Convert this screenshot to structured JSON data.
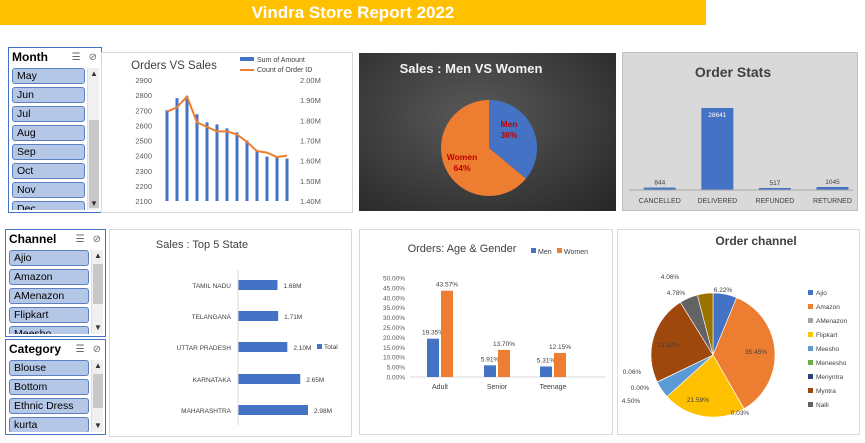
{
  "title": "Vindra Store Report 2022",
  "slicers": {
    "month": {
      "title": "Month",
      "items": [
        "May",
        "Jun",
        "Jul",
        "Aug",
        "Sep",
        "Oct",
        "Nov",
        "Dec"
      ]
    },
    "channel": {
      "title": "Channel",
      "items": [
        "Ajio",
        "Amazon",
        "AMenazon",
        "Flipkart",
        "Meesho"
      ]
    },
    "category": {
      "title": "Category",
      "items": [
        "Blouse",
        "Bottom",
        "Ethnic Dress",
        "kurta"
      ]
    }
  },
  "colors": {
    "blue": "#4472c4",
    "orange": "#ed7d31",
    "gray": "#a5a5a5",
    "yellow": "#ffc000",
    "lightblue": "#5b9bd5",
    "green": "#70ad47",
    "navy": "#264478",
    "brown": "#9e480e",
    "olive": "#997300",
    "header": "#ffc000"
  },
  "chart_data": [
    {
      "type": "bar",
      "title": "Orders VS Sales",
      "series": [
        {
          "name": "Sum of Amount",
          "type": "bar",
          "axis": "right",
          "values": [
            1.85,
            1.91,
            1.92,
            1.83,
            1.79,
            1.78,
            1.76,
            1.74,
            1.7,
            1.65,
            1.62,
            1.62,
            1.61
          ]
        },
        {
          "name": "Count of Order ID",
          "type": "line",
          "axis": "left",
          "values": [
            2690,
            2720,
            2790,
            2620,
            2590,
            2560,
            2560,
            2540,
            2490,
            2430,
            2420,
            2390,
            2400
          ]
        }
      ],
      "left_ticks": [
        "2900",
        "2800",
        "2700",
        "2600",
        "2500",
        "2400",
        "2300",
        "2200",
        "2100"
      ],
      "right_ticks": [
        "2.00M",
        "1.90M",
        "1.80M",
        "1.70M",
        "1.60M",
        "1.50M",
        "1.40M"
      ],
      "ylim_left": [
        2100,
        2900
      ],
      "ylim_right": [
        1.4,
        2.0
      ],
      "legend": "top-right"
    },
    {
      "type": "pie",
      "title": "Sales : Men VS Women",
      "slices": [
        {
          "label": "Men",
          "value": 36,
          "text": "36%",
          "color": "#4472c4"
        },
        {
          "label": "Women",
          "value": 64,
          "text": "64%",
          "color": "#ed7d31"
        }
      ]
    },
    {
      "type": "bar",
      "title": "Order Stats",
      "categories": [
        "CANCELLED",
        "DELIVERED",
        "REFUNDED",
        "RETURNED"
      ],
      "values": [
        844,
        28641,
        517,
        1045
      ],
      "labels": [
        "844",
        "28641",
        "517",
        "1045"
      ]
    },
    {
      "type": "bar",
      "orientation": "horizontal",
      "title": "Sales : Top 5 State",
      "categories": [
        "TAMIL NADU",
        "TELANGANA",
        "UTTAR PRADESH",
        "KARNATAKA",
        "MAHARASHTRA"
      ],
      "values": [
        1.68,
        1.71,
        2.1,
        2.65,
        2.98
      ],
      "labels": [
        "1.68M",
        "1.71M",
        "2.10M",
        "2.65M",
        "2.98M"
      ],
      "legend": "Total"
    },
    {
      "type": "bar",
      "title": "Orders: Age & Gender",
      "categories": [
        "Adult",
        "Senior",
        "Teenage"
      ],
      "series": [
        {
          "name": "Men",
          "values": [
            19.35,
            5.91,
            5.31
          ],
          "labels": [
            "19.35%",
            "5.91%",
            "5.31%"
          ]
        },
        {
          "name": "Women",
          "values": [
            43.57,
            13.7,
            12.15
          ],
          "labels": [
            "43.57%",
            "13.70%",
            "12.15%"
          ]
        }
      ],
      "y_ticks": [
        "50.00%",
        "45.00%",
        "40.00%",
        "35.00%",
        "30.00%",
        "25.00%",
        "20.00%",
        "15.00%",
        "10.00%",
        "5.00%",
        "0.00%"
      ],
      "ylim": [
        0,
        50
      ],
      "legend": "top"
    },
    {
      "type": "pie",
      "title": "Order channel",
      "slices": [
        {
          "label": "Ajio",
          "value": 6.22,
          "text": "6.22%",
          "color": "#4472c4"
        },
        {
          "label": "Amazon",
          "value": 35.45,
          "text": "35.45%",
          "color": "#ed7d31"
        },
        {
          "label": "AMenazon",
          "value": 0.03,
          "text": "0.03%",
          "color": "#a5a5a5"
        },
        {
          "label": "Flipkart",
          "value": 21.59,
          "text": "21.59%",
          "color": "#ffc000"
        },
        {
          "label": "Meesho",
          "value": 4.5,
          "text": "4.50%",
          "color": "#5b9bd5"
        },
        {
          "label": "Meneesho",
          "value": 0.0,
          "text": "0.00%",
          "color": "#70ad47"
        },
        {
          "label": "Menyntra",
          "value": 0.06,
          "text": "0.06%",
          "color": "#264478"
        },
        {
          "label": "Myntra",
          "value": 23.32,
          "text": "23.32%",
          "color": "#9e480e"
        },
        {
          "label": "Nalli",
          "value": 4.78,
          "text": "4.78%",
          "color": "#636363"
        },
        {
          "label": "",
          "value": 4.06,
          "text": "4.06%",
          "color": "#997300"
        }
      ]
    }
  ]
}
